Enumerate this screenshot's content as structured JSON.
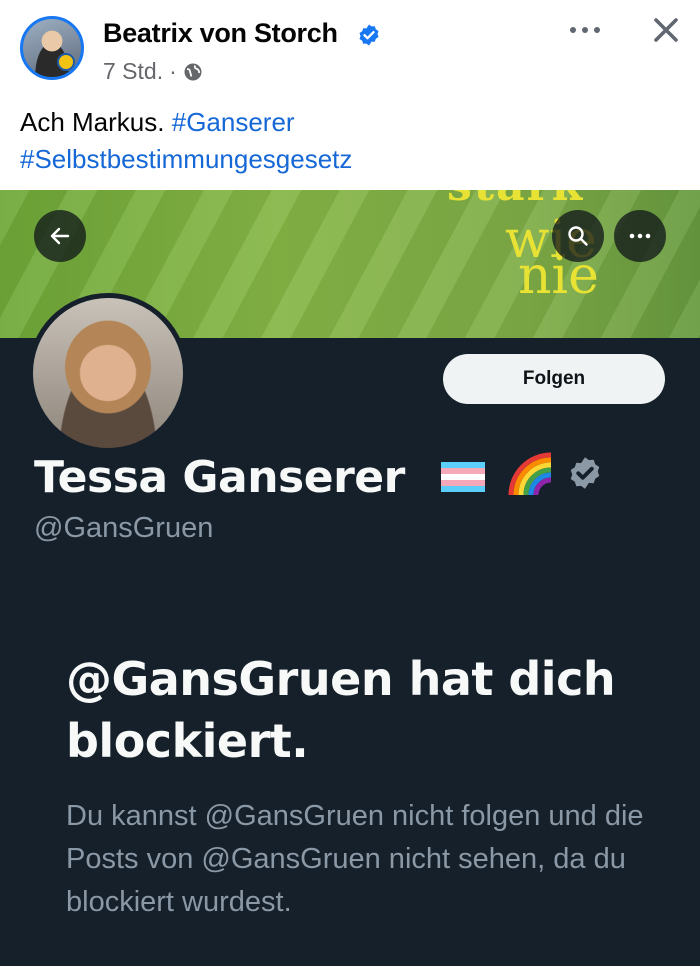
{
  "post": {
    "author_name": "Beatrix von Storch",
    "timestamp": "7 Std.",
    "separator": "·",
    "text_plain": "Ach Markus.",
    "hashtag_1": "#Ganserer",
    "hashtag_2": "#Selbstbestimmungesgesetz",
    "icons": [
      "verified-badge-icon",
      "globe-icon",
      "more-options-icon",
      "close-icon"
    ],
    "accent_color": "#1877f2"
  },
  "embedded_profile": {
    "banner_words": [
      "stark",
      "wie",
      "nie"
    ],
    "display_name": "Tessa Ganserer",
    "handle": "@GansGruen",
    "follow_label": "Folgen",
    "blocked_title": "@GansGruen hat dich blockiert.",
    "blocked_body": "Du kannst @GansGruen nicht folgen und die Posts von @GansGruen nicht sehen, da du blockiert wurdest.",
    "icons": [
      "back-arrow-icon",
      "search-icon",
      "more-options-icon",
      "transgender-flag-icon",
      "rainbow-icon",
      "verified-badge-icon"
    ],
    "background_color": "#15202b",
    "banner_color": "#7fad47"
  }
}
